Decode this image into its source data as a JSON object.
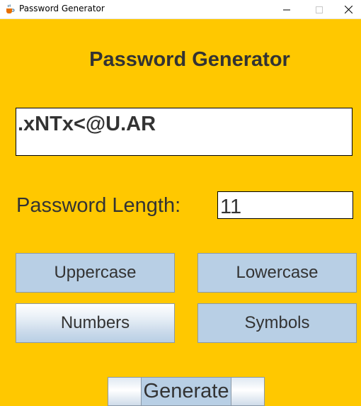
{
  "window": {
    "title": "Password Generator"
  },
  "heading": "Password Generator",
  "password": {
    "value": ".xNTx<@U.AR"
  },
  "length": {
    "label": "Password Length:",
    "value": "11"
  },
  "options": {
    "uppercase": "Uppercase",
    "lowercase": "Lowercase",
    "numbers": "Numbers",
    "symbols": "Symbols"
  },
  "generate_label": "Generate",
  "colors": {
    "background": "#ffc800",
    "button": "#b8cfe5",
    "text": "#333333"
  },
  "icons": {
    "app": "java-coffee-icon",
    "minimize": "minimize-icon",
    "maximize": "maximize-icon",
    "close": "close-icon"
  }
}
